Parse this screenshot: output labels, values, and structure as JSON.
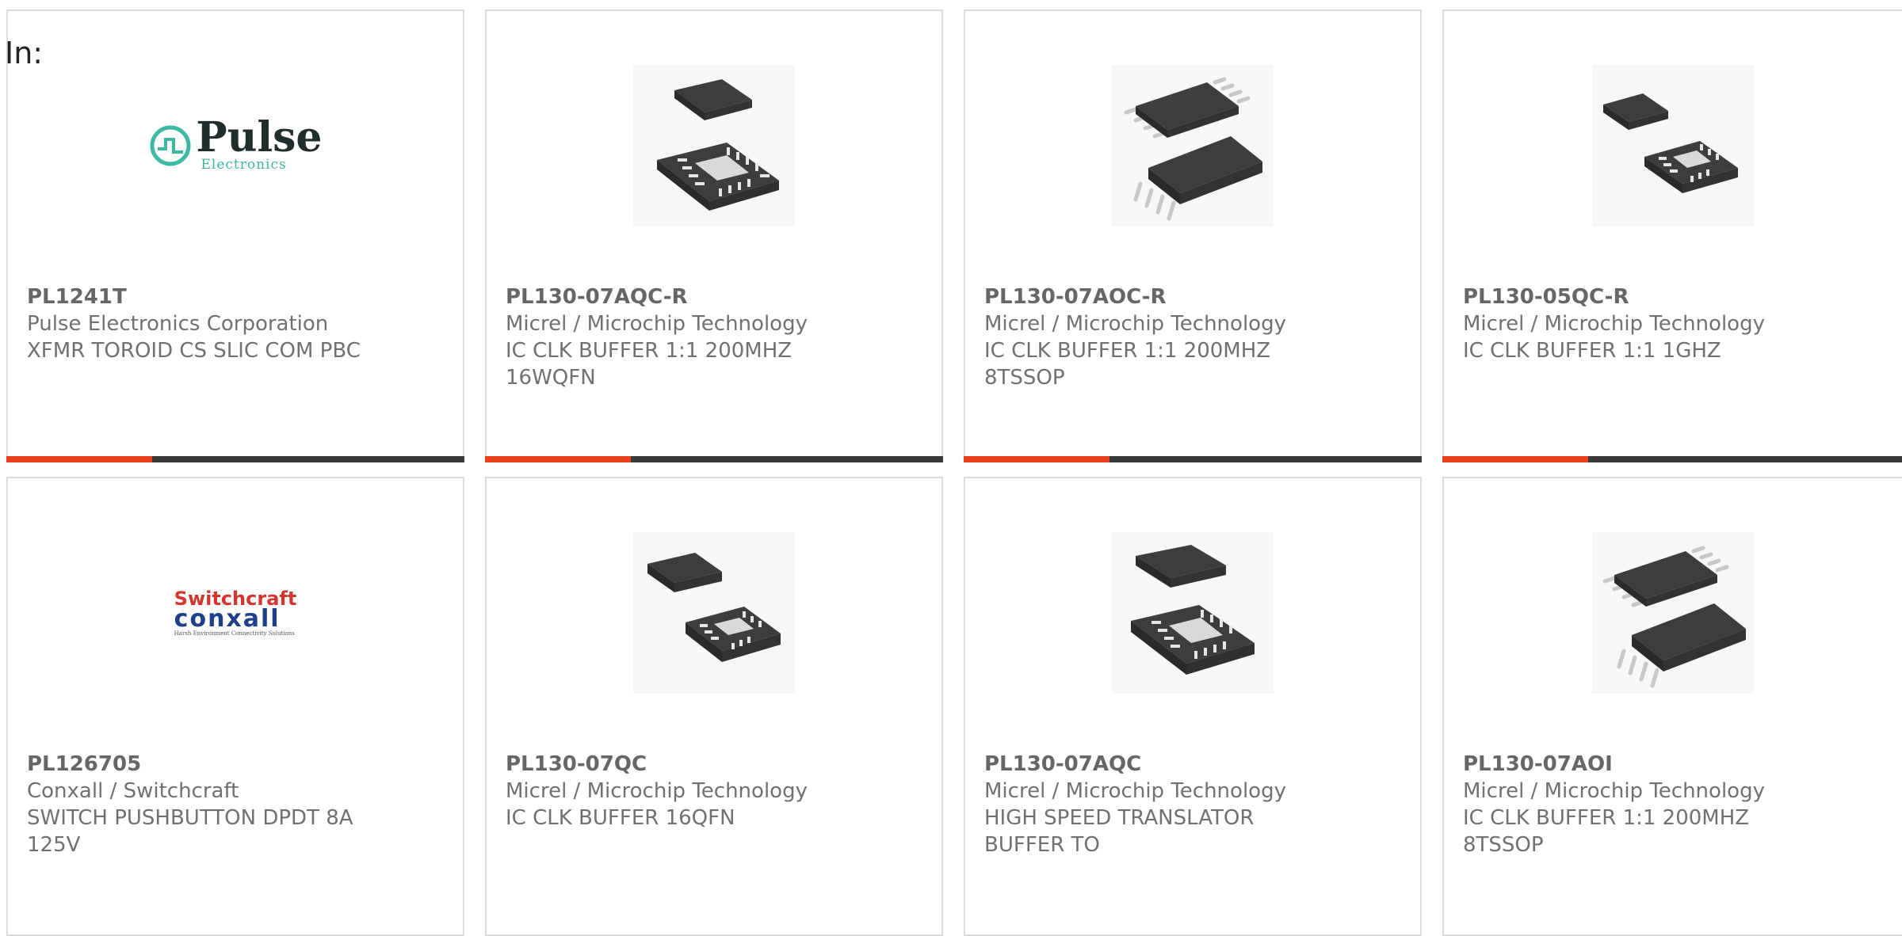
{
  "header": {
    "label": "In:"
  },
  "colors": {
    "accent": "#e8411c",
    "bar": "#3a3a3a",
    "border": "#dcdcdc",
    "pulse_green": "#3cb9a4",
    "switchcraft_red": "#d8342f",
    "conxall_blue": "#1d3f8c"
  },
  "products": [
    {
      "part_number": "PL1241T",
      "manufacturer": "Pulse Electronics Corporation",
      "description": "XFMR TOROID CS SLIC COM PBC",
      "image": "pulse-electronics-logo",
      "logo_main": "Pulse",
      "logo_sub": "Electronics"
    },
    {
      "part_number": "PL130-07AQC-R",
      "manufacturer": "Micrel / Microchip Technology",
      "description": "IC CLK BUFFER 1:1 200MHZ 16WQFN",
      "image": "qfn-package-icon"
    },
    {
      "part_number": "PL130-07AOC-R",
      "manufacturer": "Micrel / Microchip Technology",
      "description": "IC CLK BUFFER 1:1 200MHZ 8TSSOP",
      "image": "tssop-package-icon"
    },
    {
      "part_number": "PL130-05QC-R",
      "manufacturer": "Micrel / Microchip Technology",
      "description": "IC CLK BUFFER 1:1 1GHZ",
      "image": "qfn-package-small-icon"
    },
    {
      "part_number": "PL126705",
      "manufacturer": "Conxall / Switchcraft",
      "description": "SWITCH PUSHBUTTON DPDT 8A 125V",
      "image": "switchcraft-conxall-logo",
      "logo_top": "Switchcraft",
      "logo_mid": "conxall",
      "logo_bot": "Harsh Environment Connectivity Solutions"
    },
    {
      "part_number": "PL130-07QC",
      "manufacturer": "Micrel / Microchip Technology",
      "description": "IC CLK BUFFER 16QFN",
      "image": "qfn-package-small-icon"
    },
    {
      "part_number": "PL130-07AQC",
      "manufacturer": "Micrel / Microchip Technology",
      "description": "HIGH SPEED TRANSLATOR BUFFER TO",
      "image": "qfn-package-icon"
    },
    {
      "part_number": "PL130-07AOI",
      "manufacturer": "Micrel / Microchip Technology",
      "description": "IC CLK BUFFER 1:1 200MHZ 8TSSOP",
      "image": "tssop-package-icon"
    }
  ]
}
